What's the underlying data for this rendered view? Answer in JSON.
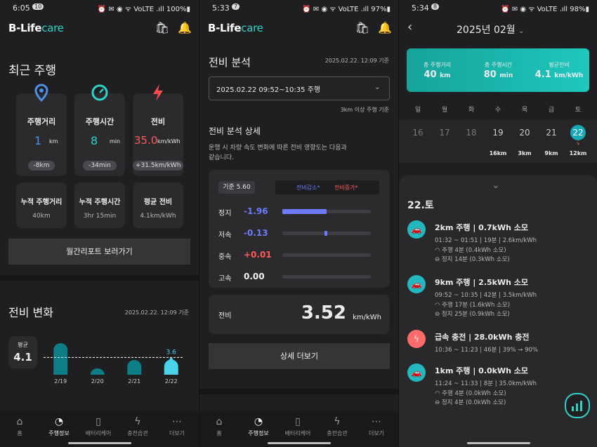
{
  "status": [
    {
      "time": "6:05",
      "badge": "10",
      "right": "⏰ ✉ ◉ ᯤ VoLTE .ıll 100%▮"
    },
    {
      "time": "5:33",
      "badge": "7",
      "right": "⏰ ✉ ◉ ᯤ VoLTE .ıll 97%▮"
    },
    {
      "time": "5:34",
      "badge": "8",
      "right": "⏰ ✉ ◉ ᯤ VoLTE .ıll 98%▮"
    }
  ],
  "brand": {
    "prefix": "B-Life",
    "suffix": "care"
  },
  "p1": {
    "title": "최근 주행",
    "stats": [
      {
        "label": "주행거리",
        "value": "1",
        "unit": "km",
        "chip": "-8km",
        "icon": "location-pin-icon",
        "color": "#4f8fe6"
      },
      {
        "label": "주행시간",
        "value": "8",
        "unit": "min",
        "chip": "-34min",
        "icon": "speedometer-icon",
        "color": "#2fd3c8"
      },
      {
        "label": "전비",
        "value": "35.0",
        "unit": "km/kWh",
        "chip": "+31.5km/kWh",
        "icon": "lightning-icon",
        "color": "#ff5a5a"
      }
    ],
    "totals": [
      {
        "label": "누적 주행거리",
        "value": "40km"
      },
      {
        "label": "누적 주행시간",
        "value": "3hr 15min"
      },
      {
        "label": "평균 전비",
        "value": "4.1km/kWh"
      }
    ],
    "report_button": "월간리포트 보러가기",
    "chart_title": "전비 변화",
    "chart_date": "2025.02.22. 12:09 기준",
    "avg_label": "평균",
    "avg_value": "4.1",
    "last_value_label": "3.6"
  },
  "chart_data": {
    "type": "bar",
    "categories": [
      "2/19",
      "2/20",
      "2/21",
      "2/22"
    ],
    "values": [
      7.5,
      1.5,
      3.5,
      3.6
    ],
    "reference_line": 4.1,
    "grid": false
  },
  "nav": [
    "홈",
    "주행정보",
    "배터리케어",
    "충전습관",
    "더보기"
  ],
  "p2": {
    "title": "전비 분석",
    "date": "2025.02.22. 12:09 기준",
    "select": "2025.02.22 09:52~10:35 주행",
    "note": "3km 이상 주행 기준",
    "detail_title": "전비 분석 상세",
    "detail_desc1": "운행 시 차량 속도 변화에 따른 전비 영향도는 다음과",
    "detail_desc2": "같습니다.",
    "baseline": "기준  5.60",
    "legend_down": "전비감소*",
    "legend_up": "전비증가*",
    "rows": [
      {
        "label": "정지",
        "value": "-1.96",
        "color": "#6d7cff",
        "fill": 0.5
      },
      {
        "label": "저속",
        "value": "-0.13",
        "color": "#6d7cff",
        "fill": 0.03
      },
      {
        "label": "중속",
        "value": "+0.01",
        "color": "#ff5a5a",
        "fill": 0.0
      },
      {
        "label": "고속",
        "value": "0.00",
        "color": "#f2f2f2",
        "fill": 0.0
      }
    ],
    "eff_label": "전비",
    "eff_value": "3.52",
    "eff_unit": "km/kWh",
    "more_button": "상세 더보기"
  },
  "p3": {
    "month": "2025년 02월",
    "summary": [
      {
        "label": "총 주행거리",
        "value": "40",
        "unit": "km"
      },
      {
        "label": "총 주행시간",
        "value": "80",
        "unit": "min"
      },
      {
        "label": "평균전비",
        "value": "4.1",
        "unit": "km/kWh"
      }
    ],
    "weekdays": [
      "일",
      "월",
      "화",
      "수",
      "목",
      "금",
      "토"
    ],
    "days": [
      {
        "d": "16",
        "km": ""
      },
      {
        "d": "17",
        "km": ""
      },
      {
        "d": "18",
        "km": ""
      },
      {
        "d": "19",
        "km": "16km"
      },
      {
        "d": "20",
        "km": "3km"
      },
      {
        "d": "21",
        "km": "9km"
      },
      {
        "d": "22",
        "km": "12km"
      }
    ],
    "day_title": "22.토",
    "events": [
      {
        "type": "drive",
        "title": "2km 주행 | 0.7kWh 소모",
        "time": "01:32 ~ 01:51 | 19분 | 2.6km/kWh",
        "l1": "주행 4분 (0.4kWh 소모)",
        "l2": "정지 14분 (0.3kWh 소모)"
      },
      {
        "type": "drive",
        "title": "9km 주행 | 2.5kWh 소모",
        "time": "09:52 ~ 10:35 | 42분 | 3.5km/kWh",
        "l1": "주행 17분 (1.6kWh 소모)",
        "l2": "정지 25분 (0.9kWh 소모)"
      },
      {
        "type": "charge",
        "title": "급속 충전 | 28.0kWh 충전",
        "time": "10:36 ~ 11:23 | 46분 | 39% → 90%",
        "l1": "",
        "l2": ""
      },
      {
        "type": "drive",
        "title": "1km 주행 | 0.0kWh 소모",
        "time": "11:24 ~ 11:33 | 8분 | 35.0km/kWh",
        "l1": "주행 4분 (0.0kWh 소모)",
        "l2": "정지 4분 (0.0kWh 소모)"
      }
    ]
  }
}
